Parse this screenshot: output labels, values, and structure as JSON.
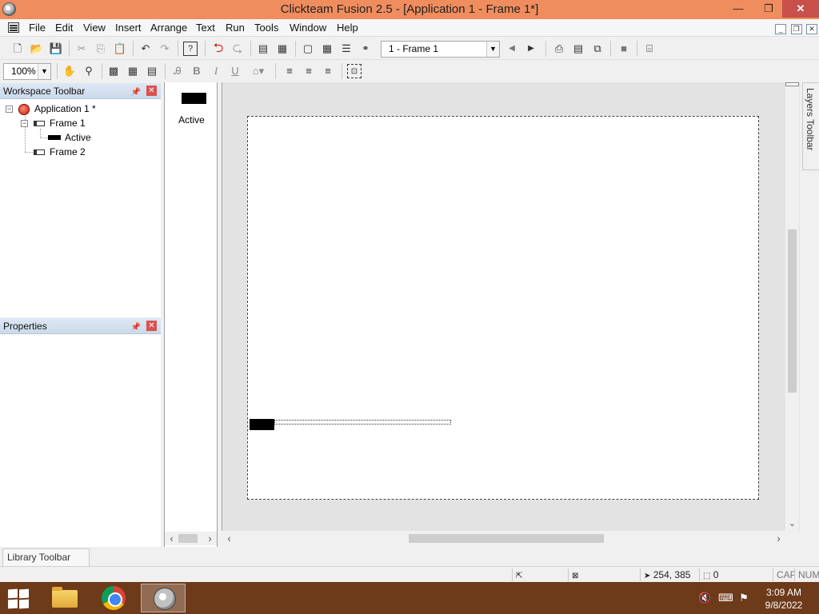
{
  "window": {
    "title": "Clickteam Fusion 2.5 - [Application 1 - Frame 1*]",
    "minimize": "—",
    "restore": "❐",
    "close": "✕"
  },
  "menu": {
    "items": [
      "File",
      "Edit",
      "View",
      "Insert",
      "Arrange",
      "Text",
      "Run",
      "Tools",
      "Window",
      "Help"
    ],
    "mdi": {
      "minimize": "_",
      "restore": "❐",
      "close": "✕"
    }
  },
  "toolbar1": {
    "frame_selector": "1 - Frame 1"
  },
  "toolbar2": {
    "zoom": "100%",
    "bold": "B",
    "italic": "I",
    "underline": "U"
  },
  "workspace": {
    "title": "Workspace Toolbar",
    "tree": {
      "application": "Application 1 *",
      "frame1": "Frame 1",
      "active_object": "Active",
      "frame2": "Frame 2"
    }
  },
  "properties": {
    "title": "Properties"
  },
  "object_shelf": {
    "objects": [
      {
        "label": "Active"
      }
    ]
  },
  "layers_toolbar": {
    "label": "Layers Toolbar"
  },
  "library_toolbar": {
    "label": "Library Toolbar"
  },
  "status_bar": {
    "coordinates": "254, 385",
    "selected_count": "0",
    "caps": "CAP",
    "num": "NUM"
  },
  "taskbar": {
    "time": "3:09 AM",
    "date": "9/8/2022"
  },
  "colors": {
    "titlebar": "#f08d5e",
    "close_button": "#c7504a",
    "taskbar": "#6d3a1a",
    "panel_header": "#d4e1ef"
  }
}
